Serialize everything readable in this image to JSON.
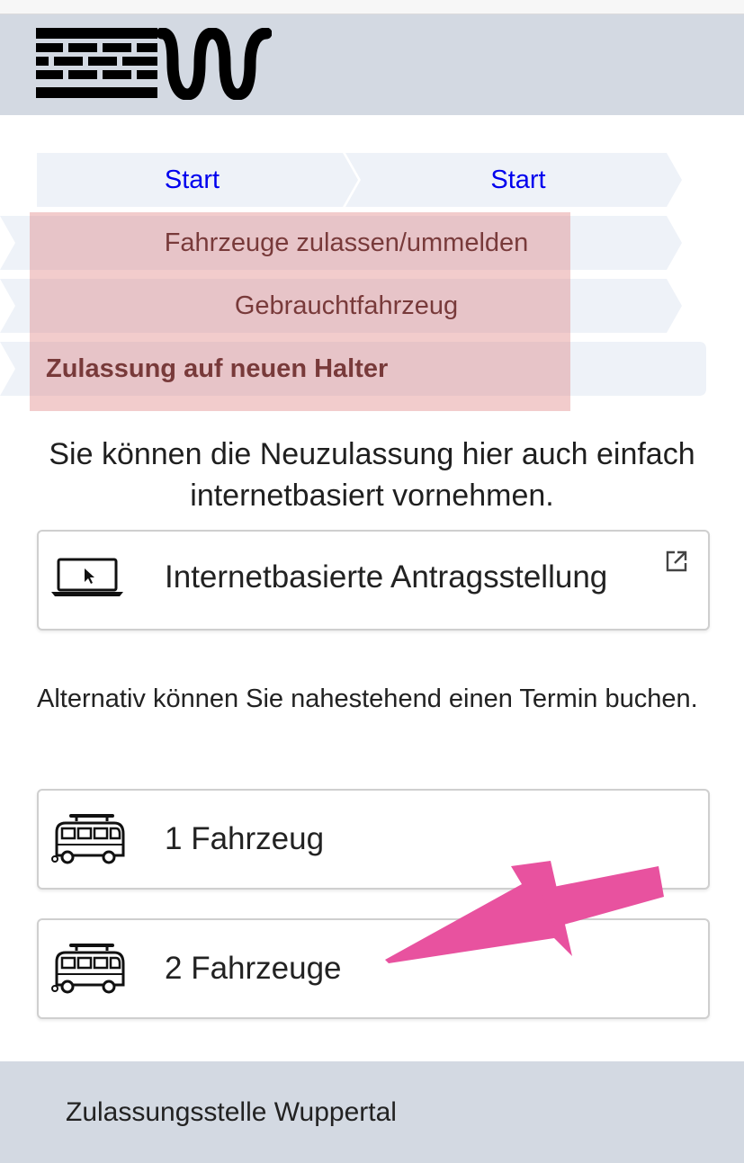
{
  "header": {
    "logo_icon": "wuppertal-logo-icon"
  },
  "breadcrumb": {
    "items": [
      {
        "label": "Start"
      },
      {
        "label": "Start"
      },
      {
        "label": "Fahrzeuge zulassen/ummelden"
      },
      {
        "label": "Gebrauchtfahrzeug"
      },
      {
        "label": "Zulassung auf neuen Halter",
        "current": true
      }
    ]
  },
  "main": {
    "intro": "Sie können die Neuzulassung hier auch einfach internetbasiert vornehmen.",
    "online_button": {
      "label": "Internetbasierte Antragsstellung",
      "icon": "laptop-cursor-icon",
      "external_icon": "external-link-icon"
    },
    "alt_text": "Alternativ können Sie nahestehend einen Termin buchen.",
    "options": [
      {
        "label": "1 Fahrzeug",
        "icon": "camper-van-icon"
      },
      {
        "label": "2 Fahrzeuge",
        "icon": "camper-van-icon"
      }
    ]
  },
  "annotation": {
    "arrow_color": "#e8529f",
    "highlight_color": "#e39a9a"
  },
  "footer": {
    "label": "Zulassungsstelle Wuppertal"
  }
}
